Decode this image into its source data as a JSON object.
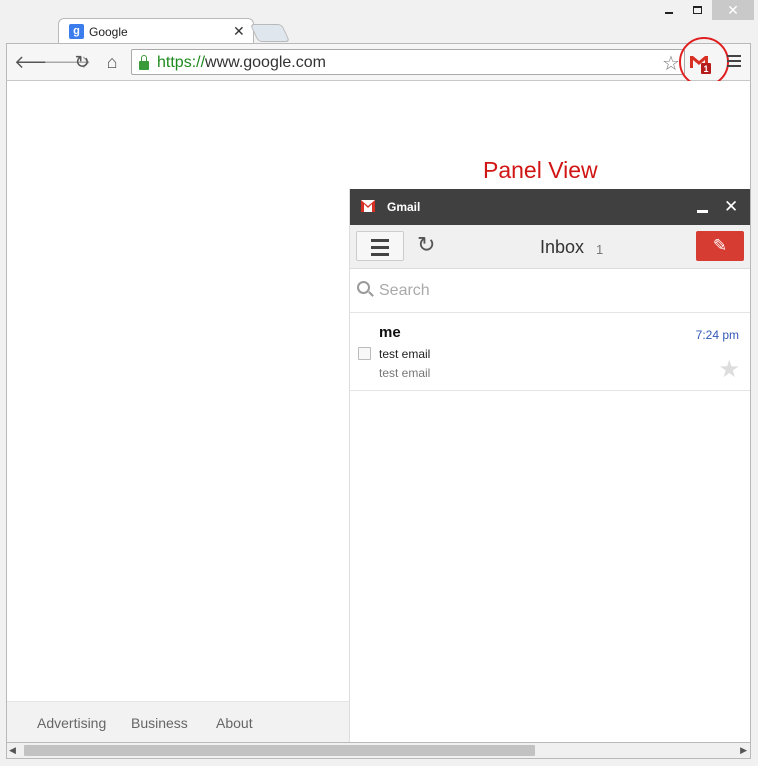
{
  "browser": {
    "tab_title": "Google",
    "url_scheme": "https://",
    "url_host": "www.google.com",
    "extension_badge": "1"
  },
  "annotation": "Panel View",
  "panel": {
    "title": "Gmail",
    "inbox_label": "Inbox",
    "inbox_count": "1",
    "search_placeholder": "Search",
    "messages": [
      {
        "from": "me",
        "time": "7:24 pm",
        "subject": "test email",
        "snippet": "test email"
      }
    ]
  },
  "footer": {
    "links": [
      "Advertising",
      "Business",
      "About"
    ]
  },
  "colors": {
    "annotation": "#d01515",
    "panel_titlebar": "#404040",
    "compose": "#d73c32",
    "time": "#3358b6"
  }
}
